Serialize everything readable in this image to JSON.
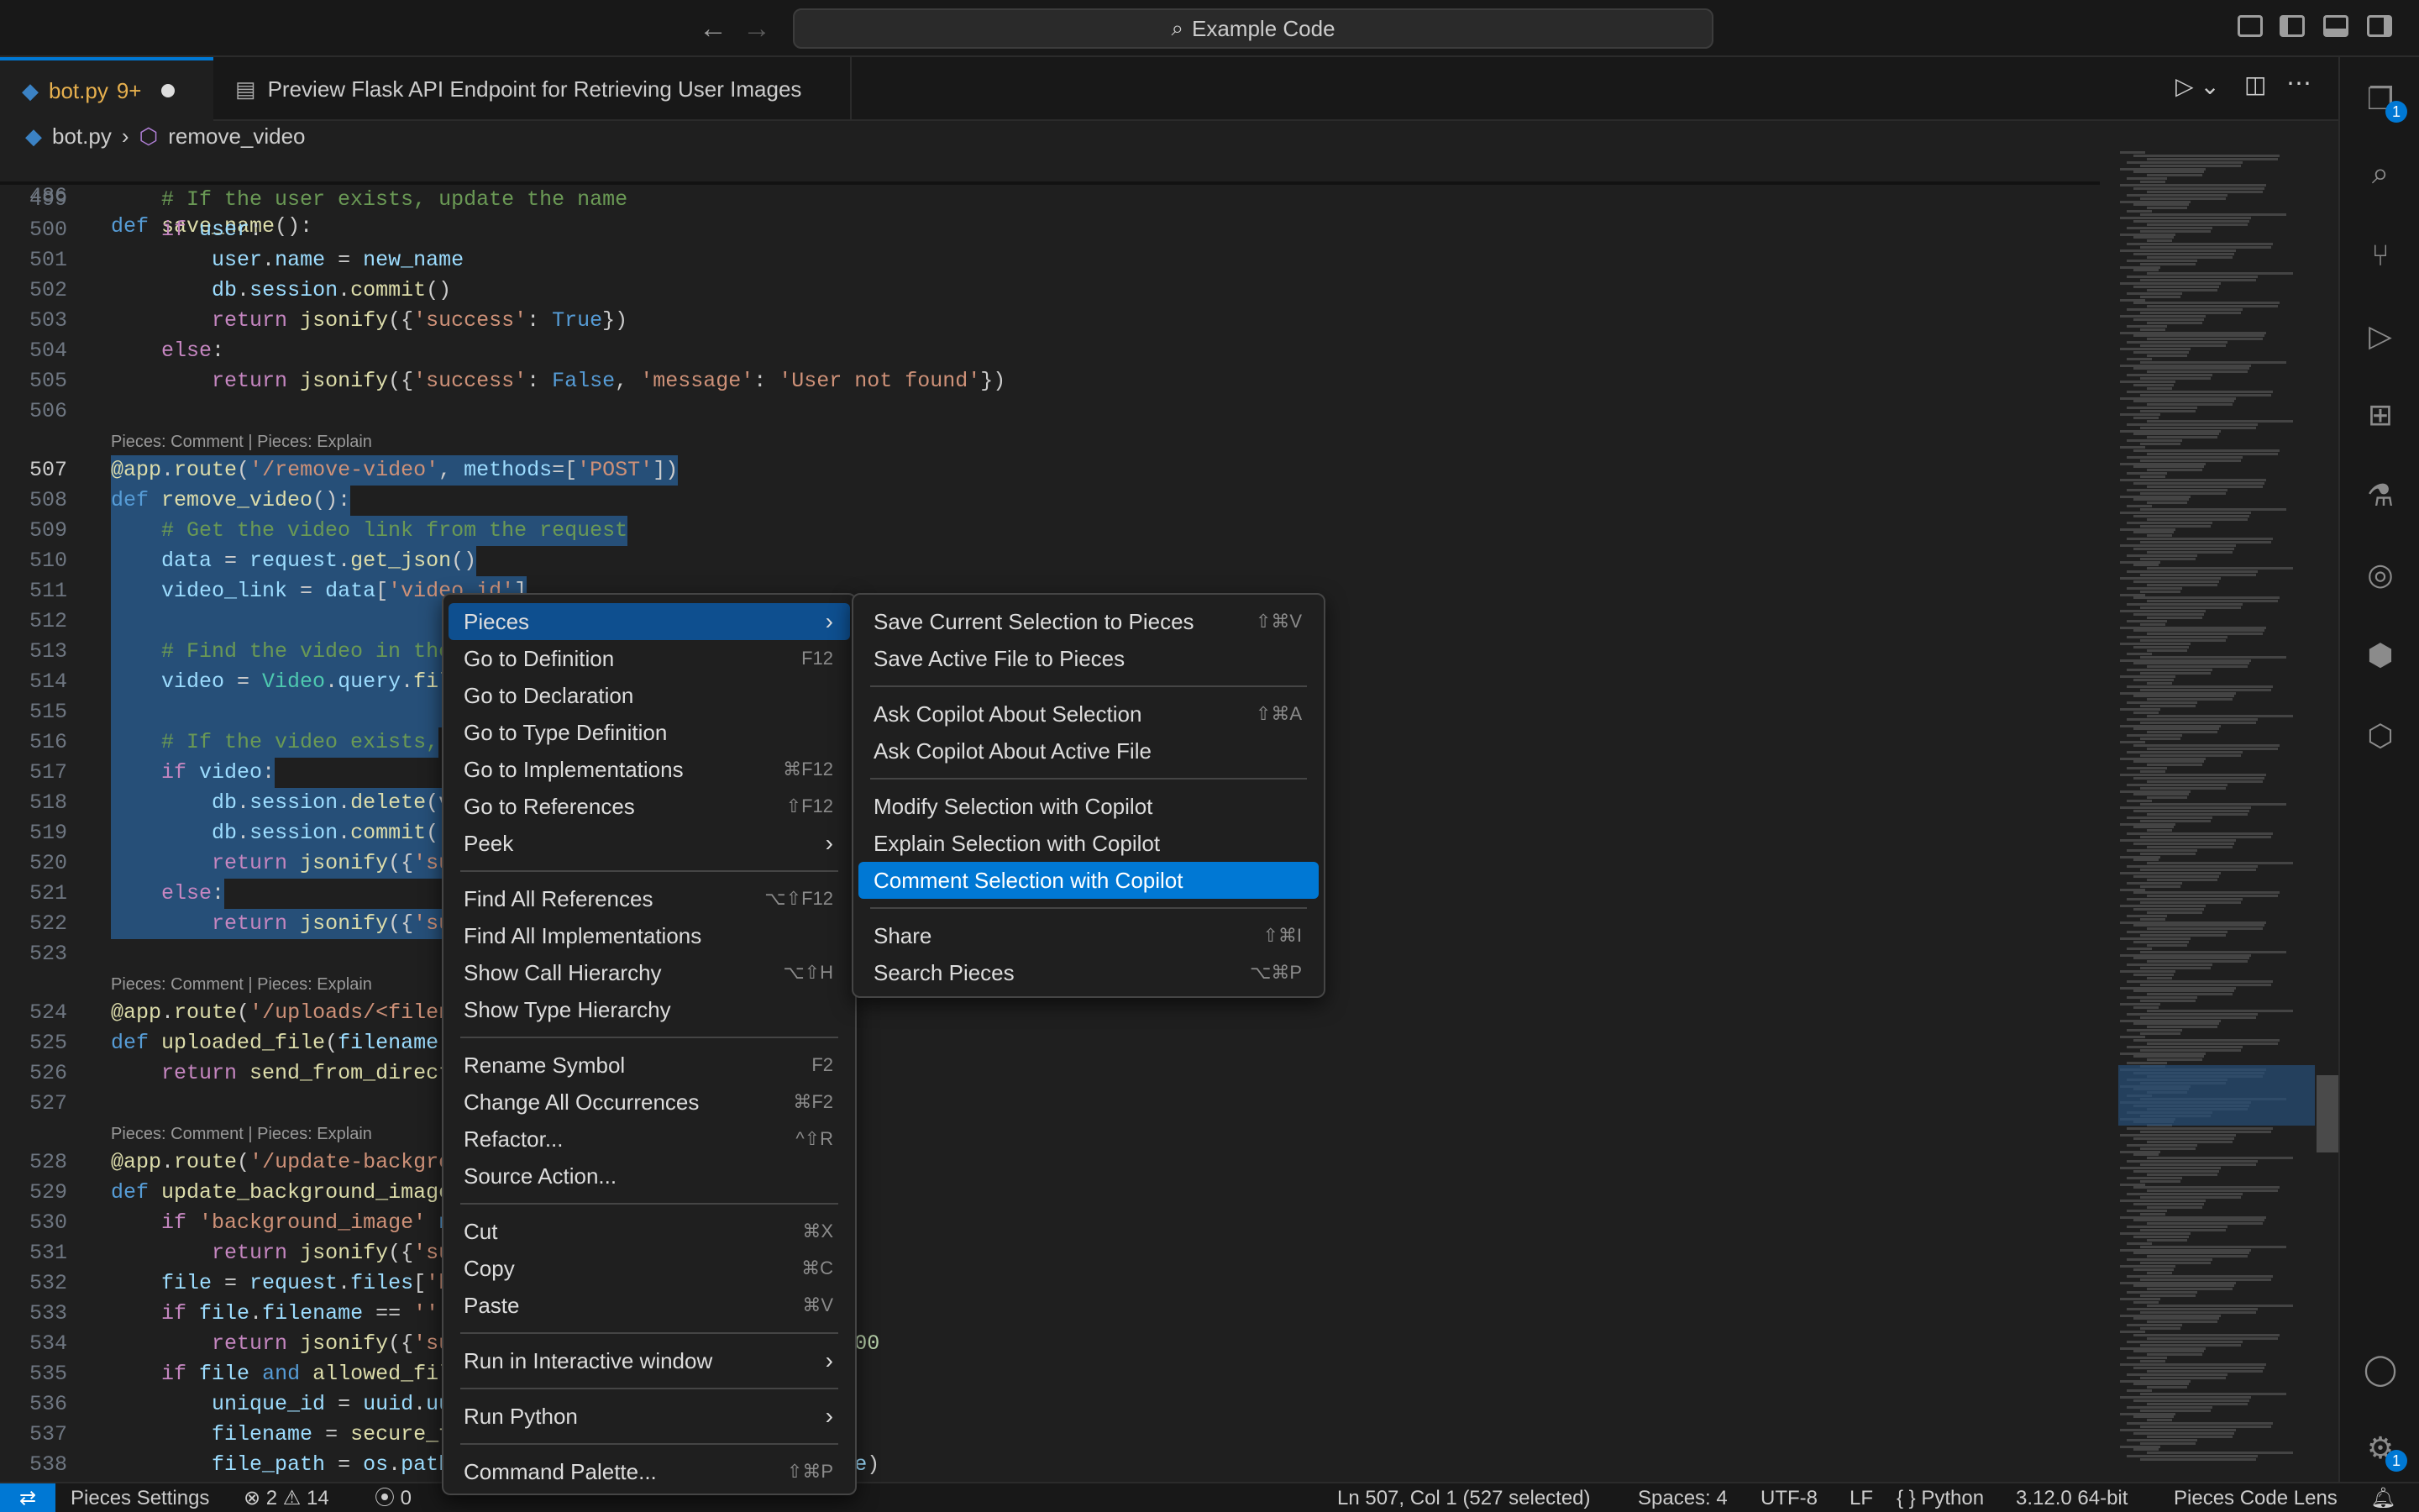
{
  "title": {
    "back_icon": "arrow-left",
    "forward_icon": "arrow-right",
    "search": "Example Code"
  },
  "tabs": [
    {
      "label": "bot.py",
      "status": "9+"
    },
    {
      "label": "Preview Flask API Endpoint for Retrieving User Images"
    }
  ],
  "breadcrumb": {
    "file": "bot.py",
    "sep": "›",
    "symbol": "remove_video"
  },
  "sticky": {
    "ln": "486",
    "code": "def save_name():"
  },
  "lines": [
    {
      "ln": "499",
      "html": "    <span class='cm'># If the user exists, update the name</span>"
    },
    {
      "ln": "500",
      "html": "    <span class='ctrl'>if</span> <span class='var'>user</span>:"
    },
    {
      "ln": "501",
      "html": "        <span class='var'>user</span>.<span class='var'>name</span> = <span class='var'>new_name</span>"
    },
    {
      "ln": "502",
      "html": "        <span class='var'>db</span>.<span class='var'>session</span>.<span class='fn'>commit</span>()"
    },
    {
      "ln": "503",
      "html": "        <span class='ctrl'>return</span> <span class='fn'>jsonify</span>({<span class='str'>'success'</span>: <span class='kw'>True</span>})"
    },
    {
      "ln": "504",
      "html": "    <span class='ctrl'>else</span>:"
    },
    {
      "ln": "505",
      "html": "        <span class='ctrl'>return</span> <span class='fn'>jsonify</span>({<span class='str'>'success'</span>: <span class='kw'>False</span>, <span class='str'>'message'</span>: <span class='str'>'User not found'</span>})"
    },
    {
      "ln": "506",
      "html": ""
    },
    {
      "lens": "Pieces: Comment | Pieces: Explain"
    },
    {
      "ln": "507",
      "active": true,
      "sel": true,
      "html": "<span class='dec'>@app</span>.<span class='dec'>route</span>(<span class='str'>'/remove-video'</span>, <span class='var'>methods</span>=[<span class='str'>'POST'</span>])"
    },
    {
      "ln": "508",
      "sel": true,
      "html": "<span class='kw'>def</span> <span class='fn'>remove_video</span>():"
    },
    {
      "ln": "509",
      "sel": true,
      "html": "    <span class='cm'># Get the video link from the request</span>"
    },
    {
      "ln": "510",
      "sel": true,
      "html": "    <span class='var'>data</span> = <span class='var'>request</span>.<span class='fn'>get_json</span>()"
    },
    {
      "ln": "511",
      "sel": true,
      "html": "    <span class='var'>video_link</span> = <span class='var'>data</span>[<span class='str'>'video_id'</span>]"
    },
    {
      "ln": "512",
      "sel": true,
      "html": "    "
    },
    {
      "ln": "513",
      "sel": true,
      "html": "    <span class='cm'># Find the video in the</span>"
    },
    {
      "ln": "514",
      "sel": true,
      "html": "    <span class='var'>video</span> = <span class='cls'>Video</span>.<span class='var'>query</span>.<span class='fn'>fil</span>"
    },
    {
      "ln": "515",
      "sel": true,
      "html": "    "
    },
    {
      "ln": "516",
      "sel": true,
      "html": "    <span class='cm'># If the video exists,</span>"
    },
    {
      "ln": "517",
      "sel": true,
      "html": "    <span class='ctrl'>if</span> <span class='var'>video</span>:"
    },
    {
      "ln": "518",
      "sel": true,
      "html": "        <span class='var'>db</span>.<span class='var'>session</span>.<span class='fn'>delete</span>(v"
    },
    {
      "ln": "519",
      "sel": true,
      "html": "        <span class='var'>db</span>.<span class='var'>session</span>.<span class='fn'>commit</span>()"
    },
    {
      "ln": "520",
      "sel": true,
      "html": "        <span class='ctrl'>return</span> <span class='fn'>jsonify</span>({<span class='str'>'su</span>"
    },
    {
      "ln": "521",
      "sel": true,
      "html": "    <span class='ctrl'>else</span>:"
    },
    {
      "ln": "522",
      "sel": true,
      "html": "        <span class='ctrl'>return</span> <span class='fn'>jsonify</span>({<span class='str'>'su</span>"
    },
    {
      "ln": "523",
      "html": ""
    },
    {
      "lens": "Pieces: Comment | Pieces: Explain"
    },
    {
      "ln": "524",
      "html": "<span class='dec'>@app</span>.<span class='dec'>route</span>(<span class='str'>'/uploads/&lt;filen</span>"
    },
    {
      "ln": "525",
      "html": "<span class='kw'>def</span> <span class='fn'>uploaded_file</span>(<span class='var'>filename</span>)"
    },
    {
      "ln": "526",
      "html": "    <span class='ctrl'>return</span> <span class='fn'>send_from_direct</span>                 <span class='str'>ST'</span>], <span class='var'>filename</span>)"
    },
    {
      "ln": "527",
      "html": ""
    },
    {
      "lens": "Pieces: Comment | Pieces: Explain"
    },
    {
      "ln": "528",
      "html": "<span class='dec'>@app</span>.<span class='dec'>route</span>(<span class='str'>'/update-backgro</span>"
    },
    {
      "ln": "529",
      "html": "<span class='kw'>def</span> <span class='fn'>update_background_image</span>"
    },
    {
      "ln": "530",
      "html": "    <span class='ctrl'>if</span> <span class='str'>'background_image'</span> <span class='kw'>n</span>"
    },
    {
      "ln": "531",
      "html": "        <span class='ctrl'>return</span> <span class='fn'>jsonify</span>({<span class='str'>'su</span>                 <span class='str'>part'</span>}), <span class='num'>400</span>"
    },
    {
      "ln": "532",
      "html": "    <span class='var'>file</span> = <span class='var'>request</span>.<span class='var'>files</span>[<span class='str'>'b</span>"
    },
    {
      "ln": "533",
      "html": "    <span class='ctrl'>if</span> <span class='var'>file</span>.<span class='var'>filename</span> == <span class='str'>''</span>:"
    },
    {
      "ln": "534",
      "html": "        <span class='ctrl'>return</span> <span class='fn'>jsonify</span>({<span class='str'>'su</span>                 <span class='str'>cted file'</span>}), <span class='num'>400</span>"
    },
    {
      "ln": "535",
      "html": "    <span class='ctrl'>if</span> <span class='var'>file</span> <span class='kw'>and</span> <span class='fn'>allowed_fil</span>"
    },
    {
      "ln": "536",
      "html": "        <span class='var'>unique_id</span> = <span class='var'>uuid</span>.<span class='var'>uu</span>"
    },
    {
      "ln": "537",
      "html": "        <span class='var'>filename</span> = <span class='fn'>secure_f</span>                  <span class='str'>me}\")</span>"
    },
    {
      "ln": "538",
      "html": "        <span class='var'>file_path</span> = <span class='var'>os</span>.<span class='var'>path</span>                 <span class='str'>DEST'</span>], <span class='var'>filename</span>)"
    }
  ],
  "context_menu": [
    {
      "label": "Pieces",
      "submenu": true,
      "hl": true
    },
    {
      "label": "Go to Definition",
      "key": "F12"
    },
    {
      "label": "Go to Declaration"
    },
    {
      "label": "Go to Type Definition"
    },
    {
      "label": "Go to Implementations",
      "key": "⌘F12"
    },
    {
      "label": "Go to References",
      "key": "⇧F12"
    },
    {
      "label": "Peek",
      "submenu": true
    },
    {
      "sep": true
    },
    {
      "label": "Find All References",
      "key": "⌥⇧F12"
    },
    {
      "label": "Find All Implementations"
    },
    {
      "label": "Show Call Hierarchy",
      "key": "⌥⇧H"
    },
    {
      "label": "Show Type Hierarchy"
    },
    {
      "sep": true
    },
    {
      "label": "Rename Symbol",
      "key": "F2"
    },
    {
      "label": "Change All Occurrences",
      "key": "⌘F2"
    },
    {
      "label": "Refactor...",
      "key": "^⇧R"
    },
    {
      "label": "Source Action..."
    },
    {
      "sep": true
    },
    {
      "label": "Cut",
      "key": "⌘X"
    },
    {
      "label": "Copy",
      "key": "⌘C"
    },
    {
      "label": "Paste",
      "key": "⌘V"
    },
    {
      "sep": true
    },
    {
      "label": "Run in Interactive window",
      "submenu": true
    },
    {
      "sep": true
    },
    {
      "label": "Run Python",
      "submenu": true
    },
    {
      "sep": true
    },
    {
      "label": "Command Palette...",
      "key": "⇧⌘P"
    }
  ],
  "submenu": [
    {
      "label": "Save Current Selection to Pieces",
      "key": "⇧⌘V"
    },
    {
      "label": "Save Active File to Pieces"
    },
    {
      "sep": true
    },
    {
      "label": "Ask Copilot About Selection",
      "key": "⇧⌘A"
    },
    {
      "label": "Ask Copilot About Active File"
    },
    {
      "sep": true
    },
    {
      "label": "Modify Selection with Copilot"
    },
    {
      "label": "Explain Selection with Copilot"
    },
    {
      "label": "Comment Selection with Copilot",
      "hl": true
    },
    {
      "sep": true
    },
    {
      "label": "Share",
      "key": "⇧⌘I"
    },
    {
      "label": "Search Pieces",
      "key": "⌥⌘P"
    }
  ],
  "status": {
    "remote": "⚡",
    "pieces": "Pieces Settings",
    "errors": "2",
    "warnings": "14",
    "ports": "0",
    "position": "Ln 507, Col 1 (527 selected)",
    "spaces": "Spaces: 4",
    "encoding": "UTF-8",
    "eol": "LF",
    "lang": "{ } Python",
    "version": "3.12.0 64-bit",
    "lens": "Pieces Code Lens"
  },
  "activity": {
    "explorer_badge": "1",
    "settings_badge": "1"
  }
}
